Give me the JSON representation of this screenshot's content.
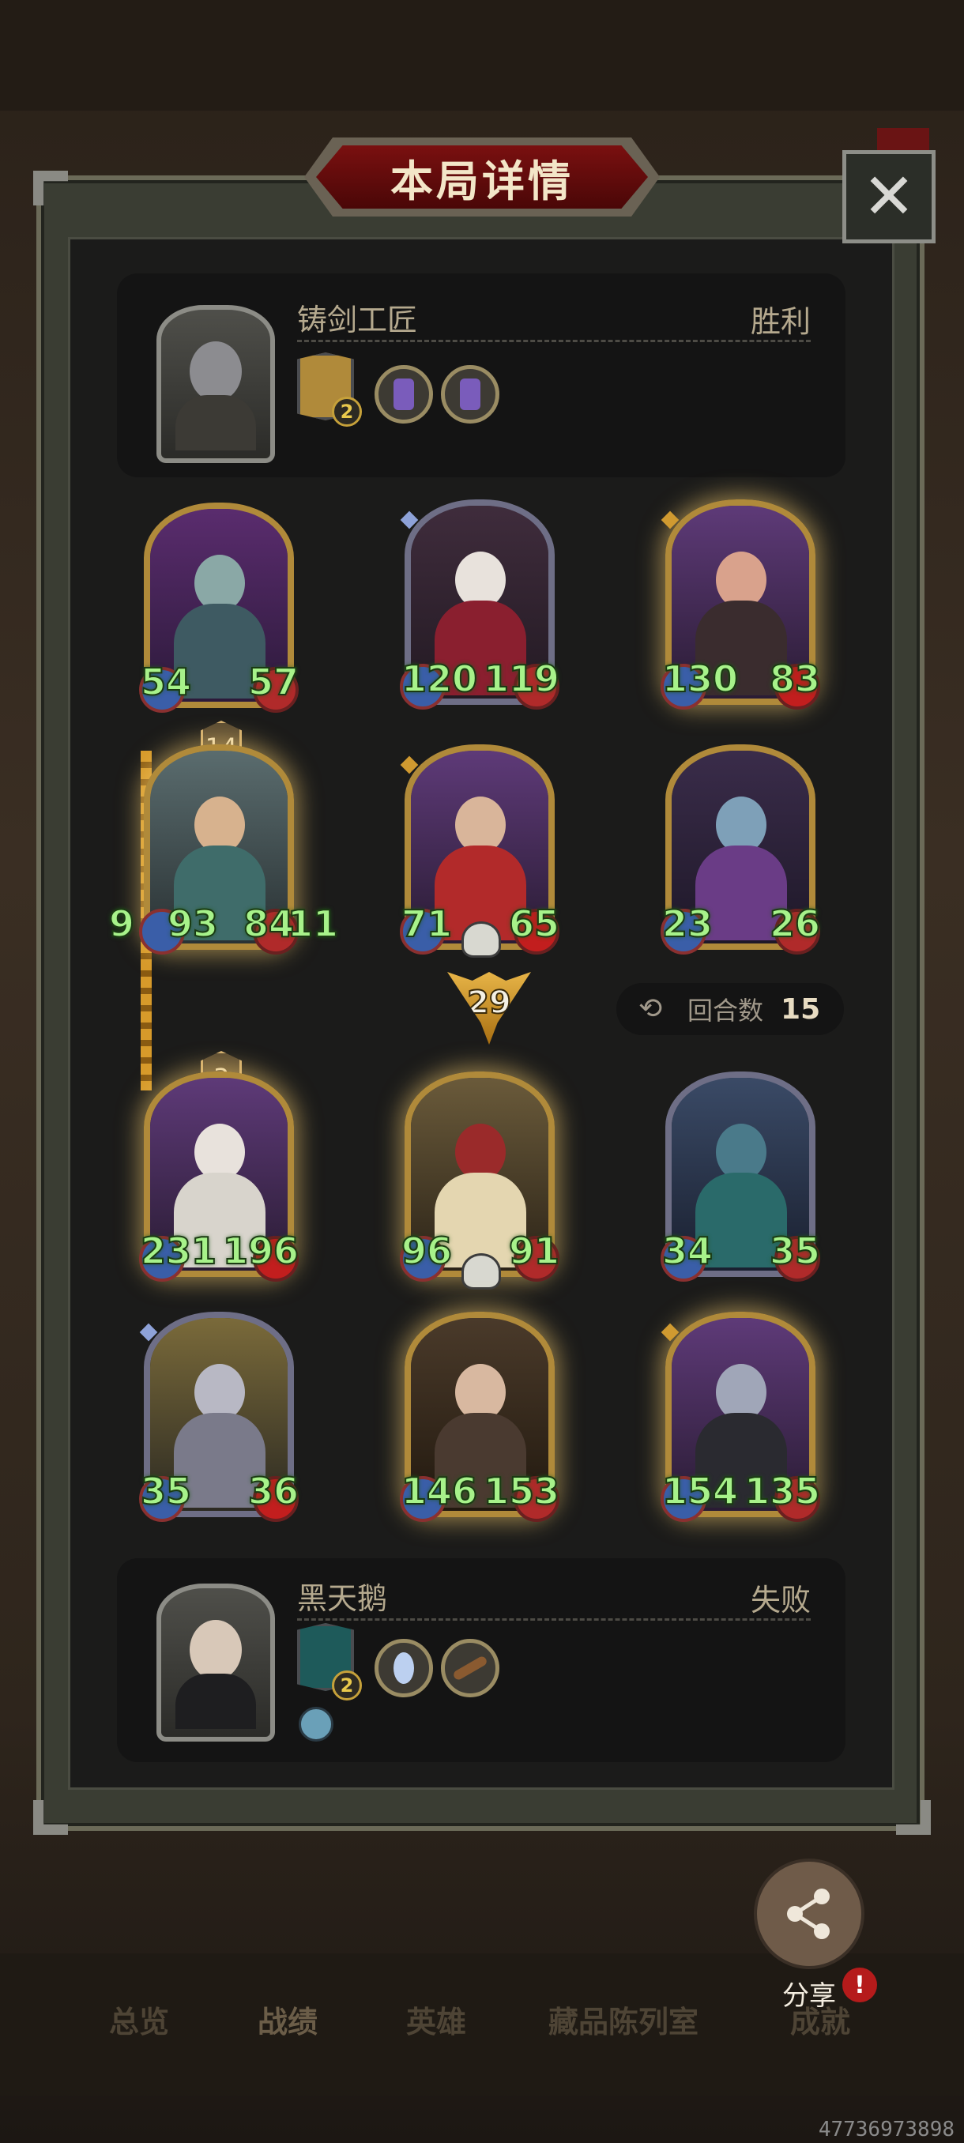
{
  "dialog": {
    "title": "本局详情",
    "close_icon": "close-icon"
  },
  "player_top": {
    "name": "铸剑工匠",
    "result": "胜利",
    "relic_level": "2"
  },
  "player_bottom": {
    "name": "黑天鹅",
    "result": "失败",
    "relic_level": "2"
  },
  "opponent_row1": [
    {
      "atk": "54",
      "hp": "57"
    },
    {
      "atk": "120",
      "hp": "119"
    },
    {
      "atk": "130",
      "hp": "83"
    }
  ],
  "opponent_row2": [
    {
      "atk": "9",
      "atk2": "93",
      "hp": "84",
      "hp2": "11",
      "level": "14"
    },
    {
      "atk": "71",
      "hp": "65"
    },
    {
      "atk": "23",
      "hp": "26"
    }
  ],
  "player_row1": [
    {
      "atk": "231",
      "hp": "196",
      "level": "3"
    },
    {
      "atk": "96",
      "hp": "91"
    },
    {
      "atk": "34",
      "hp": "35"
    }
  ],
  "player_row2": [
    {
      "atk": "35",
      "hp": "36"
    },
    {
      "atk": "146",
      "hp": "153"
    },
    {
      "atk": "154",
      "hp": "135"
    }
  ],
  "attack_marker": "29",
  "round": {
    "label": "回合数",
    "value": "15"
  },
  "share": {
    "label": "分享",
    "alert": "!"
  },
  "tabs": [
    "总览",
    "战绩",
    "英雄",
    "藏品陈列室",
    "成就"
  ],
  "watermark": "47736973898",
  "colors": {
    "accent_green": "#a7f28a",
    "gold": "#b08a3a",
    "title_red": "#7a1010"
  }
}
